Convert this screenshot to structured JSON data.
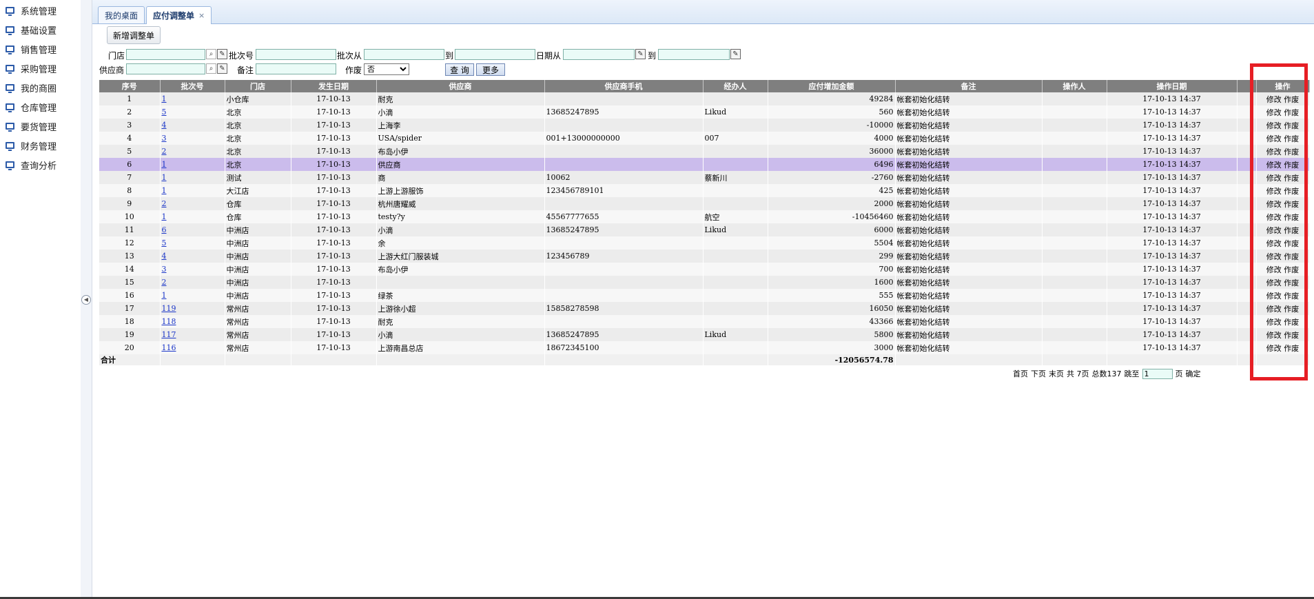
{
  "sidebar": {
    "items": [
      {
        "label": "系统管理"
      },
      {
        "label": "基础设置"
      },
      {
        "label": "销售管理"
      },
      {
        "label": "采购管理"
      },
      {
        "label": "我的商圈"
      },
      {
        "label": "仓库管理"
      },
      {
        "label": "要货管理"
      },
      {
        "label": "财务管理"
      },
      {
        "label": "查询分析"
      }
    ]
  },
  "tabs": [
    {
      "label": "我的桌面"
    },
    {
      "label": "应付调整单",
      "close": "×"
    }
  ],
  "toolbar": {
    "new_label": "新增调整单"
  },
  "filters": {
    "store_label": "门店",
    "batch_label": "批次号",
    "batch_from_label": "批次从",
    "to_label": "到",
    "date_from_label": "日期从",
    "date_to_label": "到",
    "supplier_label": "供应商",
    "remark_label": "备注",
    "void_label": "作废",
    "void_value": "否",
    "query_label": "查 询",
    "more_label": "更多"
  },
  "table": {
    "columns": [
      "序号",
      "批次号",
      "门店",
      "发生日期",
      "供应商",
      "供应商手机",
      "经办人",
      "应付增加金额",
      "备注",
      "操作人",
      "操作日期",
      "",
      "操作"
    ],
    "rows": [
      {
        "seq": "1",
        "batch": "1",
        "store": "小仓库",
        "date": "17-10-13",
        "supplier": "耐克",
        "phone": "",
        "handler": "",
        "amount": "49284",
        "remark": "帐套初始化结转",
        "operator": "",
        "opdate": "17-10-13 14:37"
      },
      {
        "seq": "2",
        "batch": "5",
        "store": "北京",
        "date": "17-10-13",
        "supplier": "小滴",
        "phone": "13685247895",
        "handler": "Likud",
        "amount": "560",
        "remark": "帐套初始化结转",
        "operator": "",
        "opdate": "17-10-13 14:37"
      },
      {
        "seq": "3",
        "batch": "4",
        "store": "北京",
        "date": "17-10-13",
        "supplier": "上海李",
        "phone": "",
        "handler": "",
        "amount": "-10000",
        "remark": "帐套初始化结转",
        "operator": "",
        "opdate": "17-10-13 14:37"
      },
      {
        "seq": "4",
        "batch": "3",
        "store": "北京",
        "date": "17-10-13",
        "supplier": "USA/spider",
        "phone": "001+13000000000",
        "handler": "007",
        "amount": "4000",
        "remark": "帐套初始化结转",
        "operator": "",
        "opdate": "17-10-13 14:37"
      },
      {
        "seq": "5",
        "batch": "2",
        "store": "北京",
        "date": "17-10-13",
        "supplier": "布岛小伊",
        "phone": "",
        "handler": "",
        "amount": "36000",
        "remark": "帐套初始化结转",
        "operator": "",
        "opdate": "17-10-13 14:37"
      },
      {
        "seq": "6",
        "batch": "1",
        "store": "北京",
        "date": "17-10-13",
        "supplier": "供应商",
        "phone": "",
        "handler": "",
        "amount": "6496",
        "remark": "帐套初始化结转",
        "operator": "",
        "opdate": "17-10-13 14:37"
      },
      {
        "seq": "7",
        "batch": "1",
        "store": "测试",
        "date": "17-10-13",
        "supplier": "商",
        "phone": "10062",
        "handler": "蔡新川",
        "amount": "-2760",
        "remark": "帐套初始化结转",
        "operator": "",
        "opdate": "17-10-13 14:37"
      },
      {
        "seq": "8",
        "batch": "1",
        "store": "大江店",
        "date": "17-10-13",
        "supplier": "上游上游服饰",
        "phone": "123456789101",
        "handler": "",
        "amount": "425",
        "remark": "帐套初始化结转",
        "operator": "",
        "opdate": "17-10-13 14:37"
      },
      {
        "seq": "9",
        "batch": "2",
        "store": "仓库",
        "date": "17-10-13",
        "supplier": "杭州唐耀威",
        "phone": "",
        "handler": "",
        "amount": "2000",
        "remark": "帐套初始化结转",
        "operator": "",
        "opdate": "17-10-13 14:37"
      },
      {
        "seq": "10",
        "batch": "1",
        "store": "仓库",
        "date": "17-10-13",
        "supplier": "testy?y",
        "phone": "45567777655",
        "handler": "航空",
        "amount": "-10456460",
        "remark": "帐套初始化结转",
        "operator": "",
        "opdate": "17-10-13 14:37"
      },
      {
        "seq": "11",
        "batch": "6",
        "store": "中洲店",
        "date": "17-10-13",
        "supplier": "小滴",
        "phone": "13685247895",
        "handler": "Likud",
        "amount": "6000",
        "remark": "帐套初始化结转",
        "operator": "",
        "opdate": "17-10-13 14:37"
      },
      {
        "seq": "12",
        "batch": "5",
        "store": "中洲店",
        "date": "17-10-13",
        "supplier": "余",
        "phone": "",
        "handler": "",
        "amount": "5504",
        "remark": "帐套初始化结转",
        "operator": "",
        "opdate": "17-10-13 14:37"
      },
      {
        "seq": "13",
        "batch": "4",
        "store": "中洲店",
        "date": "17-10-13",
        "supplier": "上游大红门服装城",
        "phone": "123456789",
        "handler": "",
        "amount": "299",
        "remark": "帐套初始化结转",
        "operator": "",
        "opdate": "17-10-13 14:37"
      },
      {
        "seq": "14",
        "batch": "3",
        "store": "中洲店",
        "date": "17-10-13",
        "supplier": "布岛小伊",
        "phone": "",
        "handler": "",
        "amount": "700",
        "remark": "帐套初始化结转",
        "operator": "",
        "opdate": "17-10-13 14:37"
      },
      {
        "seq": "15",
        "batch": "2",
        "store": "中洲店",
        "date": "17-10-13",
        "supplier": "",
        "phone": "",
        "handler": "",
        "amount": "1600",
        "remark": "帐套初始化结转",
        "operator": "",
        "opdate": "17-10-13 14:37"
      },
      {
        "seq": "16",
        "batch": "1",
        "store": "中洲店",
        "date": "17-10-13",
        "supplier": "绿茶",
        "phone": "",
        "handler": "",
        "amount": "555",
        "remark": "帐套初始化结转",
        "operator": "",
        "opdate": "17-10-13 14:37"
      },
      {
        "seq": "17",
        "batch": "119",
        "store": "常州店",
        "date": "17-10-13",
        "supplier": "上游徐小超",
        "phone": "15858278598",
        "handler": "",
        "amount": "16050",
        "remark": "帐套初始化结转",
        "operator": "",
        "opdate": "17-10-13 14:37"
      },
      {
        "seq": "18",
        "batch": "118",
        "store": "常州店",
        "date": "17-10-13",
        "supplier": "耐克",
        "phone": "",
        "handler": "",
        "amount": "43366",
        "remark": "帐套初始化结转",
        "operator": "",
        "opdate": "17-10-13 14:37"
      },
      {
        "seq": "19",
        "batch": "117",
        "store": "常州店",
        "date": "17-10-13",
        "supplier": "小滴",
        "phone": "13685247895",
        "handler": "Likud",
        "amount": "5800",
        "remark": "帐套初始化结转",
        "operator": "",
        "opdate": "17-10-13 14:37"
      },
      {
        "seq": "20",
        "batch": "116",
        "store": "常州店",
        "date": "17-10-13",
        "supplier": "上游南昌总店",
        "phone": "18672345100",
        "handler": "",
        "amount": "3000",
        "remark": "帐套初始化结转",
        "operator": "",
        "opdate": "17-10-13 14:37"
      }
    ],
    "action_edit": "修改",
    "action_void": "作废",
    "total_label": "合计",
    "total_amount": "-12056574.78",
    "highlighted_row": 6
  },
  "pager": {
    "first": "首页",
    "next": "下页",
    "last": "末页",
    "total_pages": "共 7页",
    "total_count": "总数137",
    "goto": "跳至",
    "page_value": "1",
    "page_suffix": "页",
    "confirm": "确定"
  },
  "colors": {
    "highlight_box": "#e61e24",
    "selected_row": "#cbbcec",
    "header": "#7f7f7f"
  }
}
